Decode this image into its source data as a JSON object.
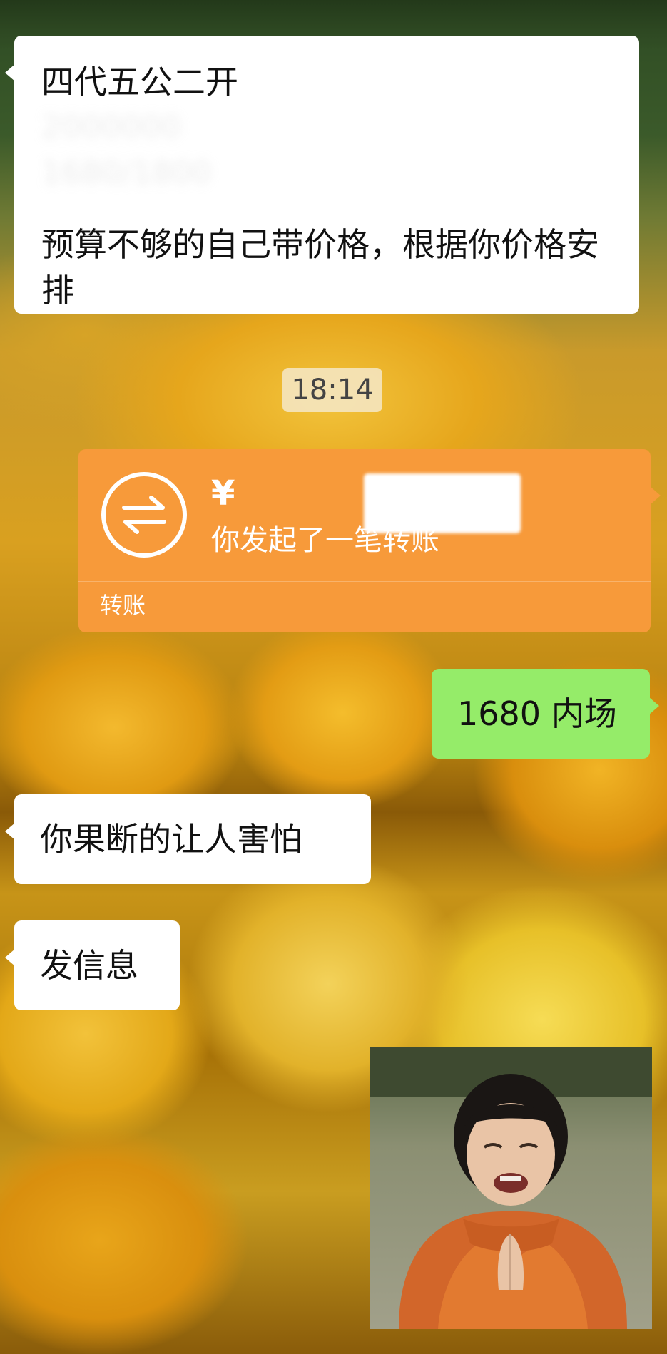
{
  "messages": [
    {
      "side": "left",
      "lines": [
        "四代五公二开",
        "预算不够的自己带价格，根据你价格安排"
      ],
      "blurred_lines": [
        "2000000",
        "1680/1800"
      ]
    }
  ],
  "timestamp": "18:14",
  "transfer": {
    "currency_symbol": "¥",
    "description": "你发起了一笔转账",
    "label": "转账",
    "icon": "transfer-arrows-icon",
    "color": "#f79a3a"
  },
  "reply_right": "1680 内场",
  "reply_left_1": "你果断的让人害怕",
  "reply_left_2": "发信息",
  "sticker": {
    "icon": "crying-child-praying-sticker"
  },
  "colors": {
    "bubble_left": "#ffffff",
    "bubble_right": "#95ec69",
    "transfer": "#f79a3a"
  }
}
